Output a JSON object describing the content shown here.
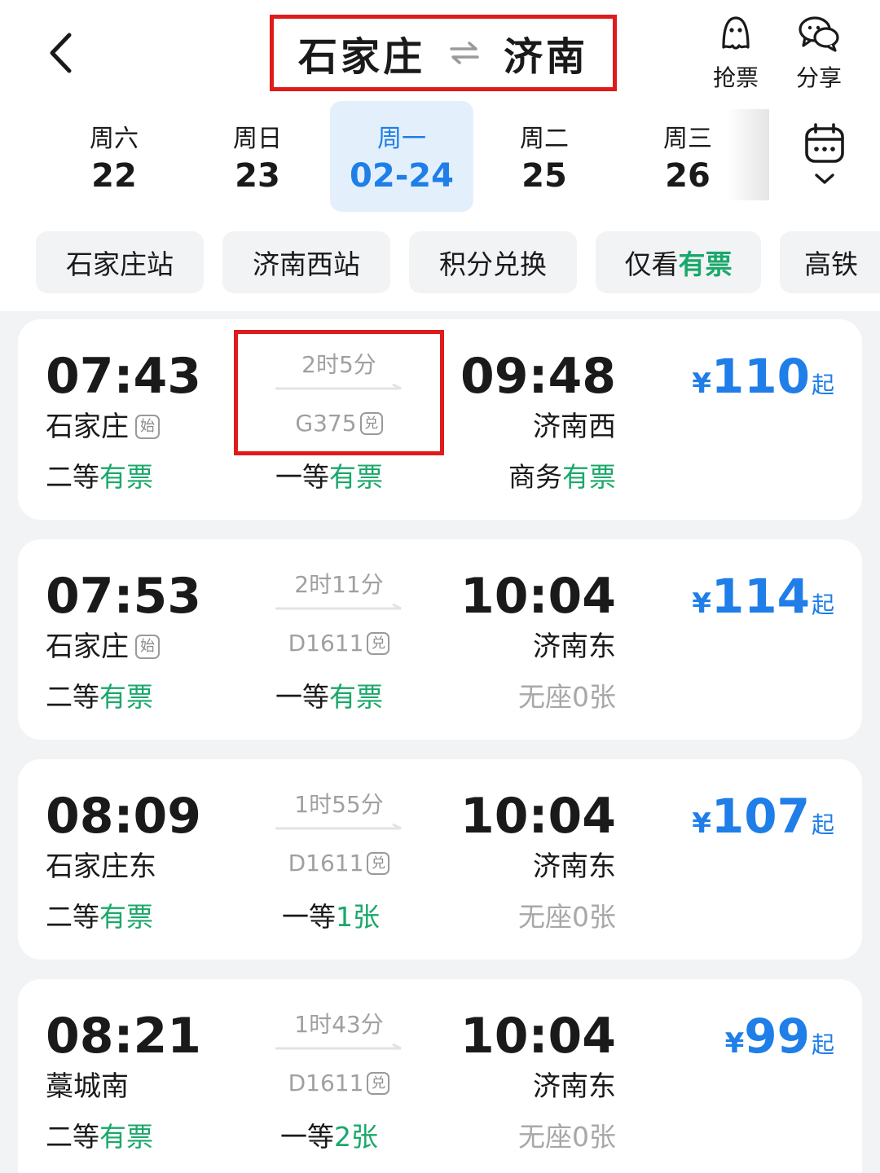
{
  "header": {
    "from": "石家庄",
    "to": "济南",
    "grab_label": "抢票",
    "share_label": "分享"
  },
  "dates": [
    {
      "weekday": "周六",
      "date": "22",
      "active": false
    },
    {
      "weekday": "周日",
      "date": "23",
      "active": false
    },
    {
      "weekday": "周一",
      "date": "02-24",
      "active": true
    },
    {
      "weekday": "周二",
      "date": "25",
      "active": false
    },
    {
      "weekday": "周三",
      "date": "26",
      "active": false
    }
  ],
  "filters": {
    "f0": "石家庄站",
    "f1": "济南西站",
    "f2": "积分兑换",
    "f3_prefix": "仅看",
    "f3_highlight": "有票",
    "f4": "高铁"
  },
  "trains": [
    {
      "dep_time": "07:43",
      "dep_station": "石家庄",
      "dep_tag": "始",
      "duration": "2时5分",
      "train_no": "G375",
      "train_tag": "兑",
      "arr_time": "09:48",
      "arr_station": "济南西",
      "price_currency": "¥",
      "price": "110",
      "price_suffix": "起",
      "seats": [
        {
          "cls": "二等",
          "status": "有票",
          "grey": false
        },
        {
          "cls": "一等",
          "status": "有票",
          "grey": false
        },
        {
          "cls": "商务",
          "status": "有票",
          "grey": false
        }
      ]
    },
    {
      "dep_time": "07:53",
      "dep_station": "石家庄",
      "dep_tag": "始",
      "duration": "2时11分",
      "train_no": "D1611",
      "train_tag": "兑",
      "arr_time": "10:04",
      "arr_station": "济南东",
      "price_currency": "¥",
      "price": "114",
      "price_suffix": "起",
      "seats": [
        {
          "cls": "二等",
          "status": "有票",
          "grey": false
        },
        {
          "cls": "一等",
          "status": "有票",
          "grey": false
        },
        {
          "cls": "无座",
          "status": "0张",
          "grey": true
        }
      ]
    },
    {
      "dep_time": "08:09",
      "dep_station": "石家庄东",
      "dep_tag": "",
      "duration": "1时55分",
      "train_no": "D1611",
      "train_tag": "兑",
      "arr_time": "10:04",
      "arr_station": "济南东",
      "price_currency": "¥",
      "price": "107",
      "price_suffix": "起",
      "seats": [
        {
          "cls": "二等",
          "status": "有票",
          "grey": false
        },
        {
          "cls": "一等",
          "status": "1张",
          "grey": false
        },
        {
          "cls": "无座",
          "status": "0张",
          "grey": true
        }
      ]
    },
    {
      "dep_time": "08:21",
      "dep_station": "藁城南",
      "dep_tag": "",
      "duration": "1时43分",
      "train_no": "D1611",
      "train_tag": "兑",
      "arr_time": "10:04",
      "arr_station": "济南东",
      "price_currency": "¥",
      "price": "99",
      "price_suffix": "起",
      "seats": [
        {
          "cls": "二等",
          "status": "有票",
          "grey": false
        },
        {
          "cls": "一等",
          "status": "2张",
          "grey": false
        },
        {
          "cls": "无座",
          "status": "0张",
          "grey": true
        }
      ]
    }
  ],
  "colors": {
    "accent_blue": "#1f7ee8",
    "available_green": "#1aa86a",
    "annotation_red": "#e01b1b"
  }
}
